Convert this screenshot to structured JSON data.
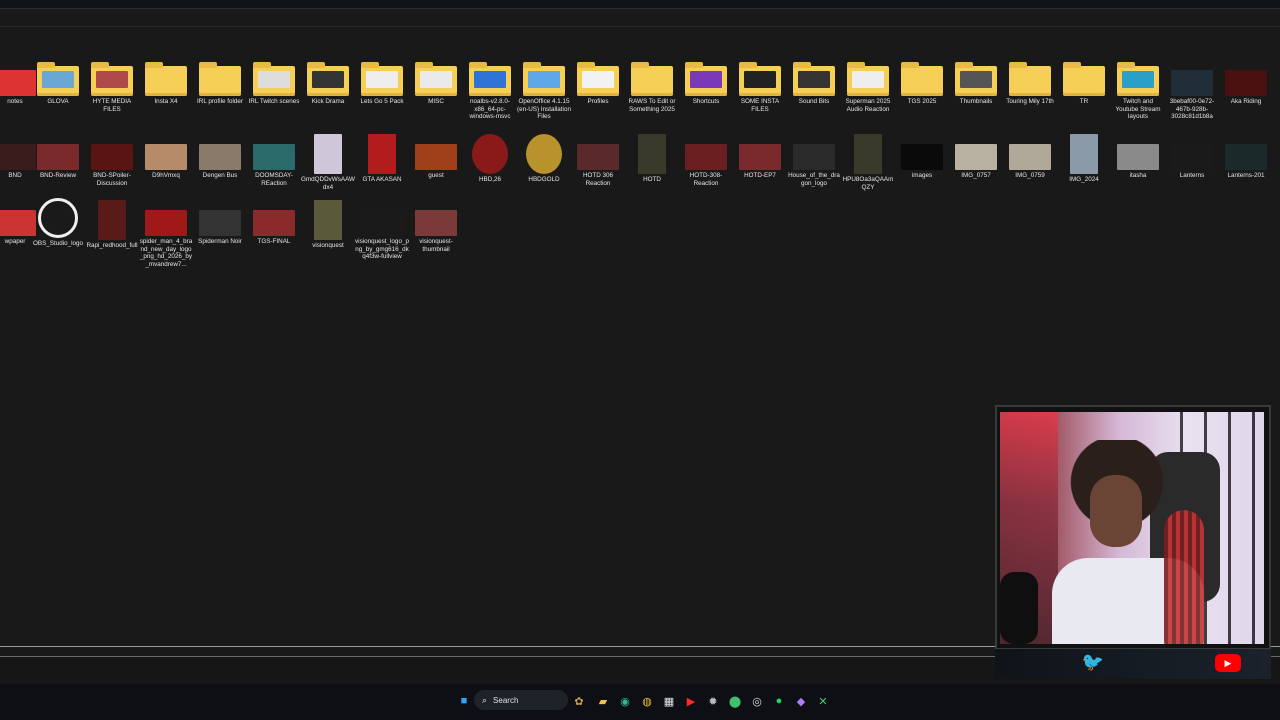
{
  "desktop": {
    "row1": [
      {
        "name": "notes-item",
        "label": "notes",
        "type": "img",
        "color": "#d33"
      },
      {
        "name": "glova-folder",
        "label": "GLOVA",
        "type": "folder",
        "inner": "#6aa6d6"
      },
      {
        "name": "hyte-media-folder",
        "label": "HYTE MEDIA FILES",
        "type": "folder",
        "inner": "#b04a4a"
      },
      {
        "name": "insta-x4-folder",
        "label": "Insta X4",
        "type": "folder"
      },
      {
        "name": "irl-profile-folder",
        "label": "IRL profile folder",
        "type": "folder"
      },
      {
        "name": "irl-twitch-folder",
        "label": "IRL Twitch scenes",
        "type": "folder",
        "inner": "#ddd"
      },
      {
        "name": "kick-drama-folder",
        "label": "Kick Drama",
        "type": "folder",
        "inner": "#333"
      },
      {
        "name": "lets-go-5-folder",
        "label": "Lets Go 5 Pack",
        "type": "folder",
        "inner": "#eee"
      },
      {
        "name": "misc-folder",
        "label": "MISC",
        "type": "folder",
        "inner": "#eaeaea"
      },
      {
        "name": "noalbs-folder",
        "label": "noalbs-v2.8.0-x86_64-pc-windows-msvc",
        "type": "folder",
        "inner": "#2d74d6"
      },
      {
        "name": "openoffice-folder",
        "label": "OpenOffice 4.1.15 (en-US) Installation Files",
        "type": "folder",
        "inner": "#5fa7e8"
      },
      {
        "name": "profiles-folder",
        "label": "Profiles",
        "type": "folder",
        "inner": "#f2f2f2"
      },
      {
        "name": "raws-folder",
        "label": "RAWS To Edit or Something 2025",
        "type": "folder"
      },
      {
        "name": "shortcuts-folder",
        "label": "Shortcuts",
        "type": "folder",
        "inner": "#7a3ab8"
      },
      {
        "name": "some-insta-folder",
        "label": "SOME INSTA FILES",
        "type": "folder",
        "inner": "#222"
      },
      {
        "name": "sound-bits-folder",
        "label": "Sound Bits",
        "type": "folder",
        "inner": "#333"
      },
      {
        "name": "superman-folder",
        "label": "Superman 2025 Audio Reaction",
        "type": "folder",
        "inner": "#eee"
      },
      {
        "name": "tgs-2025-folder",
        "label": "TGS 2025",
        "type": "folder"
      },
      {
        "name": "thumbnails-folder",
        "label": "Thumbnails",
        "type": "folder",
        "inner": "#555"
      },
      {
        "name": "touring-folder",
        "label": "Touring Mily 17th",
        "type": "folder"
      },
      {
        "name": "tr-folder",
        "label": "TR",
        "type": "folder"
      },
      {
        "name": "twitch-yt-folder",
        "label": "Twitch and Youtube Stream layouts",
        "type": "folder",
        "inner": "#2aa0c8"
      },
      {
        "name": "uuid-item",
        "label": "3bebaf00-0e72-467b-928b-3028c81d1b8a",
        "type": "img",
        "color": "#1f2d38"
      },
      {
        "name": "aka-riding-item",
        "label": "Aka Riding",
        "type": "img",
        "color": "#4a1010"
      }
    ],
    "row2": [
      {
        "name": "bnd-item",
        "label": "BND",
        "type": "img",
        "color": "#3a1c1c"
      },
      {
        "name": "bnd-review-item",
        "label": "BND-Review",
        "type": "img",
        "color": "#7a2a2a"
      },
      {
        "name": "bnd-spoiler-item",
        "label": "BND-SPoiler-Discussion",
        "type": "img",
        "color": "#5a1414"
      },
      {
        "name": "d9hvmxq-item",
        "label": "D9hVmxq",
        "type": "img",
        "color": "#b58b6a"
      },
      {
        "name": "dengen-bus-item",
        "label": "Dengen Bus",
        "type": "img",
        "color": "#8a7a6a"
      },
      {
        "name": "doomsday-item",
        "label": "DOOMSDAY-REaction",
        "type": "img",
        "color": "#2a6a6a"
      },
      {
        "name": "gmdqd-item",
        "label": "GmdQDDvWsAAWdx4",
        "type": "img",
        "color": "#cfc7d9",
        "shape": "tall"
      },
      {
        "name": "gta-akasan-item",
        "label": "GTA AKASAN",
        "type": "img",
        "color": "#b31c1c",
        "shape": "tall"
      },
      {
        "name": "guest-item",
        "label": "guest",
        "type": "img",
        "color": "#a0401a"
      },
      {
        "name": "hbd26-item",
        "label": "HBD,26",
        "type": "img",
        "color": "#8a1a1a",
        "shape": "badge"
      },
      {
        "name": "hbdgold-item",
        "label": "HBDGOLD",
        "type": "img",
        "color": "#b8922a",
        "shape": "badge"
      },
      {
        "name": "hotd306-item",
        "label": "HOTD 306 Reaction",
        "type": "img",
        "color": "#5a2a2a"
      },
      {
        "name": "hotd-item",
        "label": "HOTD",
        "type": "img",
        "color": "#3a3a2a",
        "shape": "tall"
      },
      {
        "name": "hotd308-item",
        "label": "HOTD-308-Reaction",
        "type": "img",
        "color": "#6a2020"
      },
      {
        "name": "hotd-ep7-item",
        "label": "HOTD-EP7",
        "type": "img",
        "color": "#7a2a2a"
      },
      {
        "name": "house-dragon-logo-item",
        "label": "House_of_the_dragon_logo",
        "type": "img",
        "color": "#2a2a2a"
      },
      {
        "name": "hpu-item",
        "label": "HPU8Oa3aQAAmQZY",
        "type": "img",
        "color": "#3a3a2a",
        "shape": "tall"
      },
      {
        "name": "images-item",
        "label": "images",
        "type": "img",
        "color": "#0a0a0a"
      },
      {
        "name": "img0757-item",
        "label": "IMG_0757",
        "type": "img",
        "color": "#b8b0a0"
      },
      {
        "name": "img0759-item",
        "label": "IMG_0759",
        "type": "img",
        "color": "#b0a898"
      },
      {
        "name": "img2024-item",
        "label": "IMG_2024",
        "type": "img",
        "color": "#8a9aa8",
        "shape": "tall"
      },
      {
        "name": "itasha-item",
        "label": "itasha",
        "type": "img",
        "color": "#8a8a8a"
      },
      {
        "name": "lanterns-item",
        "label": "Lanterns",
        "type": "img",
        "color": "#1a1a1a"
      },
      {
        "name": "lanterns-201-item",
        "label": "Lanterns-201",
        "type": "img",
        "color": "#1a2a2a"
      }
    ],
    "row3": [
      {
        "name": "wallpaper-item",
        "label": "wpaper",
        "type": "img",
        "color": "#c33"
      },
      {
        "name": "obs-logo-item",
        "label": "OBS_Studio_logo",
        "type": "obs"
      },
      {
        "name": "rapi-item",
        "label": "Rapi_redhood_full",
        "type": "img",
        "color": "#5a1a1a",
        "shape": "tall"
      },
      {
        "name": "spiderman4-item",
        "label": "spider_man_4_brand_new_day_logo_png_hd_2026_by_mvandrew7...",
        "type": "img",
        "color": "#a01818"
      },
      {
        "name": "spiderman-noir-item",
        "label": "Spiderman Noir",
        "type": "img",
        "color": "#333"
      },
      {
        "name": "tgs-final-item",
        "label": "TGS-FINAL",
        "type": "img",
        "color": "#8a2a2a"
      },
      {
        "name": "visionquest-item",
        "label": "visionquest",
        "type": "img",
        "color": "#5a5a3a",
        "shape": "tall"
      },
      {
        "name": "visionquest-logo-item",
        "label": "visionquest_logo_png_by_gmg616_dkq4f3w-fullview",
        "type": "img",
        "color": "#1a1a1a"
      },
      {
        "name": "visionquest-thumb-item",
        "label": "visionquest-thumbnail",
        "type": "img",
        "color": "#7a3a3a"
      }
    ]
  },
  "taskbar": {
    "search_placeholder": "Search",
    "icons": [
      {
        "name": "windows-start-icon",
        "glyph": "■",
        "color": "#2aa6ff"
      },
      {
        "name": "widgets-icon",
        "glyph": "✿",
        "color": "#caa24a"
      },
      {
        "name": "file-explorer-icon",
        "glyph": "▰",
        "color": "#f2c14e"
      },
      {
        "name": "edge-icon",
        "glyph": "◉",
        "color": "#2dbd8a"
      },
      {
        "name": "chrome-icon",
        "glyph": "◍",
        "color": "#e6c13a"
      },
      {
        "name": "calendar-icon",
        "glyph": "▦",
        "color": "#e6e6e6"
      },
      {
        "name": "youtube-icon",
        "glyph": "▶",
        "color": "#ff2a2a"
      },
      {
        "name": "settings-icon",
        "glyph": "✹",
        "color": "#bcbcbc"
      },
      {
        "name": "xbox-app-icon",
        "glyph": "⬤",
        "color": "#3fbf6f"
      },
      {
        "name": "obs-taskbar-icon",
        "glyph": "◎",
        "color": "#dddddd"
      },
      {
        "name": "spotify-icon",
        "glyph": "●",
        "color": "#1ed760"
      },
      {
        "name": "browser-icon",
        "glyph": "◆",
        "color": "#b17bff"
      },
      {
        "name": "xbox-icon",
        "glyph": "✕",
        "color": "#40d070"
      }
    ]
  },
  "overlay": {
    "twitter_glyph": "🐦",
    "youtube_glyph": "▶"
  }
}
